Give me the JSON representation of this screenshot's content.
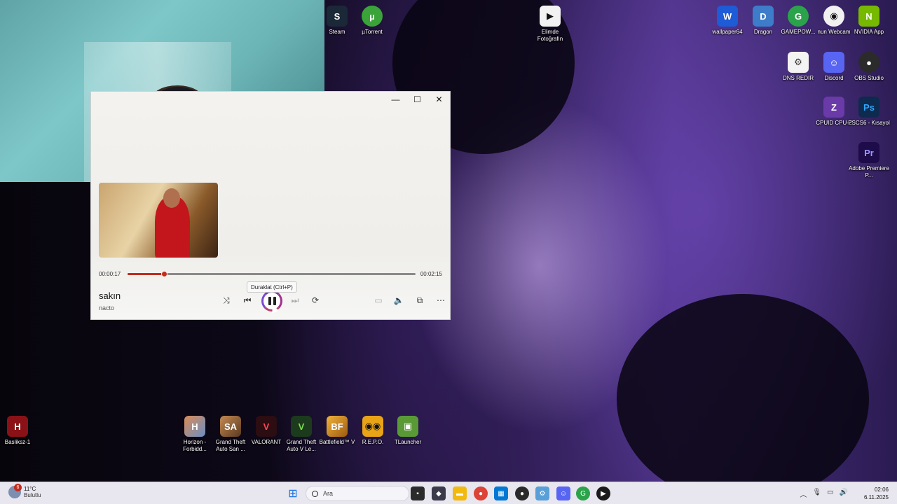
{
  "player": {
    "time_elapsed": "00:00:17",
    "time_total": "00:02:15",
    "progress": 0.126,
    "song_title": "sakın",
    "artist": "nacto",
    "tooltip": "Duraklat (Ctrl+P)",
    "titlebar": {
      "minimize": "—",
      "maximize": "☐",
      "close": "✕"
    },
    "accent_color": "#c42b1c"
  },
  "desktop_icons": [
    {
      "label": "Steam",
      "icon": "steam-icon"
    },
    {
      "label": "µTorrent",
      "icon": "utorrent-icon"
    },
    {
      "label": "Elimde Fotoğrafın",
      "icon": "media-file-icon"
    },
    {
      "label": "wallpaper64",
      "icon": "wallpaper-engine-icon"
    },
    {
      "label": "Dragon",
      "icon": "dragon-icon"
    },
    {
      "label": "GAMEPOW...",
      "icon": "gamepower-icon"
    },
    {
      "label": "nun Webcam",
      "icon": "webcam-icon"
    },
    {
      "label": "NVIDIA App",
      "icon": "nvidia-icon"
    },
    {
      "label": "DNS REDIR",
      "icon": "dns-icon"
    },
    {
      "label": "Discord",
      "icon": "discord-icon"
    },
    {
      "label": "OBS Studio",
      "icon": "obs-icon"
    },
    {
      "label": "CPUID CPU-Z",
      "icon": "cpuz-icon"
    },
    {
      "label": "PSCS6 - Kısayol",
      "icon": "photoshop-icon"
    },
    {
      "label": "Adobe Premiere P...",
      "icon": "premiere-icon"
    },
    {
      "label": "Basliksz-1",
      "icon": "image-file-icon"
    },
    {
      "label": "Horizon - Forbidd...",
      "icon": "horizon-icon"
    },
    {
      "label": "Grand Theft Auto San ...",
      "icon": "gta-sa-icon"
    },
    {
      "label": "VALORANT",
      "icon": "valorant-icon"
    },
    {
      "label": "Grand Theft Auto V Le...",
      "icon": "gta-v-icon"
    },
    {
      "label": "Battlefield™ V",
      "icon": "battlefield-icon"
    },
    {
      "label": "R.E.P.O.",
      "icon": "repo-icon"
    },
    {
      "label": "TLauncher",
      "icon": "tlauncher-icon"
    }
  ],
  "taskbar": {
    "weather_temp": "11°C",
    "weather_cond": "Bulutlu",
    "weather_badge": "6",
    "search_placeholder": "Ara",
    "time": "02:06",
    "date": "6.11.2025"
  }
}
